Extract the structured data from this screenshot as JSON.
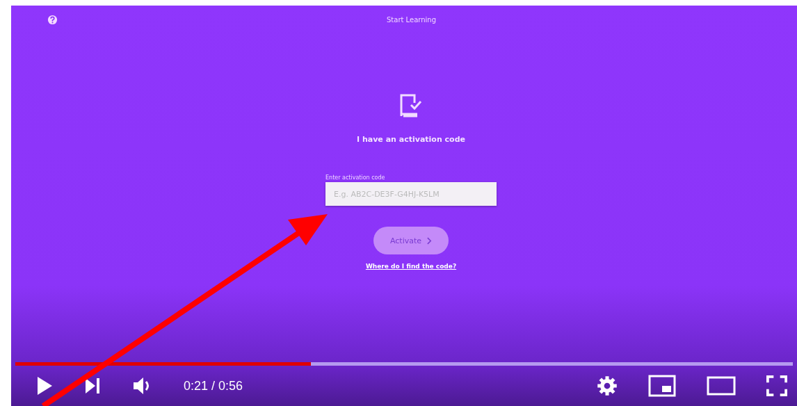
{
  "page": {
    "title": "Start Learning",
    "heading": "I have an activation code",
    "field": {
      "label": "Enter activation code",
      "placeholder": "E.g. AB2C-DE3F-G4HJ-K5LM"
    },
    "button": {
      "label": "Activate",
      "disabled": true
    },
    "link": "Where do I find the code?"
  },
  "player": {
    "progress": {
      "level": 0.38
    },
    "time": "0:21 / 0:56"
  }
}
